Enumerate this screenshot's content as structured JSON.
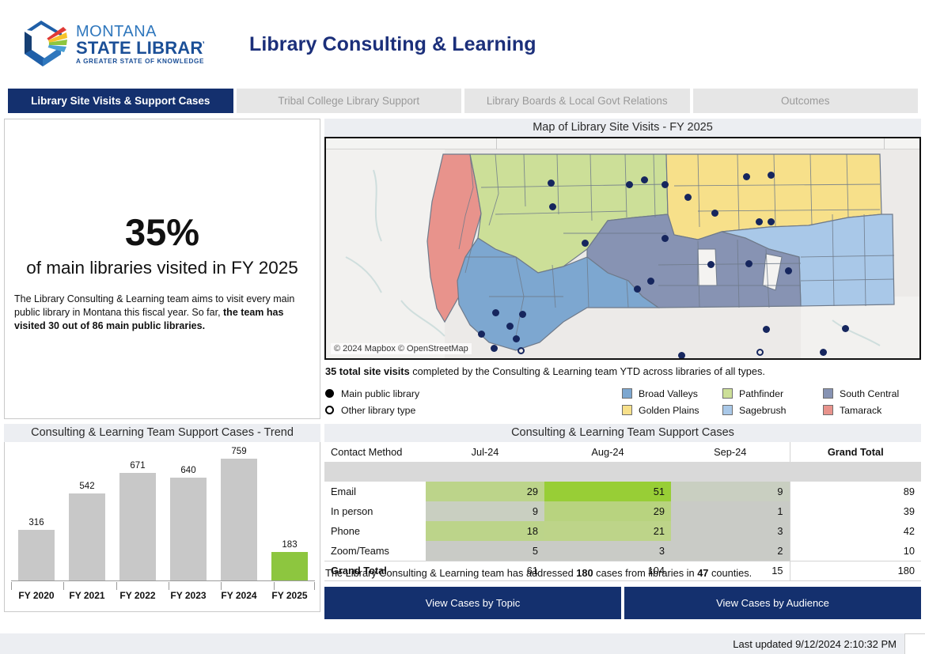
{
  "header": {
    "logo_alt": "Montana State Library",
    "logo_line1": "MONTANA",
    "logo_line2": "STATE LIBRARY",
    "logo_tagline": "A GREATER STATE OF KNOWLEDGE",
    "title": "Library Consulting & Learning"
  },
  "tabs": [
    {
      "label": "Library Site Visits & Support Cases",
      "active": true
    },
    {
      "label": "Tribal College Library Support",
      "active": false
    },
    {
      "label": "Library Boards & Local Govt Relations",
      "active": false
    },
    {
      "label": "Outcomes",
      "active": false
    }
  ],
  "kpi": {
    "value": "35%",
    "subtitle": "of main libraries visited in FY 2025",
    "paragraph_plain_1": "The Library Consulting & Learning team aims to visit every main public library in Montana this fiscal year. So far, ",
    "paragraph_bold": "the team has visited 30 out of 86 main public libraries."
  },
  "map": {
    "title": "Map of Library Site Visits - FY 2025",
    "attribution": "© 2024 Mapbox © OpenStreetMap",
    "caption_bold": "35 total site visits",
    "caption_rest": " completed by the Consulting & Learning team YTD across libraries of all types.",
    "marker_legend": [
      {
        "label": "Main public library",
        "style": "filled"
      },
      {
        "label": "Other library type",
        "style": "hollow"
      }
    ],
    "region_legend": [
      {
        "label": "Broad Valleys",
        "color": "#7da7d0"
      },
      {
        "label": "Golden Plains",
        "color": "#f7e08a"
      },
      {
        "label": "Pathfinder",
        "color": "#ccdf98"
      },
      {
        "label": "Sagebrush",
        "color": "#a9c8e8"
      },
      {
        "label": "South Central",
        "color": "#8793b3"
      },
      {
        "label": "Tamarack",
        "color": "#e8938c"
      }
    ]
  },
  "chart_data": {
    "type": "bar",
    "title": "Consulting & Learning Team Support Cases - Trend",
    "categories": [
      "FY 2020",
      "FY 2021",
      "FY 2022",
      "FY 2023",
      "FY 2024",
      "FY 2025"
    ],
    "values": [
      316,
      542,
      671,
      640,
      759,
      183
    ],
    "bar_colors": [
      "#c8c8c8",
      "#c8c8c8",
      "#c8c8c8",
      "#c8c8c8",
      "#c8c8c8",
      "#8dc63f"
    ],
    "xlabel": "",
    "ylabel": "",
    "ylim": [
      0,
      820
    ],
    "grid": false,
    "legend": "none",
    "data_labels": true
  },
  "cases_table": {
    "title": "Consulting & Learning Team Support Cases",
    "columns": [
      "Contact Method",
      "Jul-24",
      "Aug-24",
      "Sep-24",
      "Grand Total"
    ],
    "rows": [
      {
        "label": "Email",
        "values": [
          "29",
          "51",
          "9"
        ],
        "cell_colors": [
          "#bcd48a",
          "#98ce36",
          "#c9cfc1"
        ],
        "total": "89"
      },
      {
        "label": "In person",
        "values": [
          "9",
          "29",
          "1"
        ],
        "cell_colors": [
          "#c9cfc1",
          "#b8d37f",
          "#c9cbc6"
        ],
        "total": "39"
      },
      {
        "label": "Phone",
        "values": [
          "18",
          "21",
          "3"
        ],
        "cell_colors": [
          "#bcd48a",
          "#bdd489",
          "#c9cbc6"
        ],
        "total": "42"
      },
      {
        "label": "Zoom/Teams",
        "values": [
          "5",
          "3",
          "2"
        ],
        "cell_colors": [
          "#c9cbc6",
          "#c9cbc6",
          "#c9cbc6"
        ],
        "total": "10"
      }
    ],
    "grand_total_label": "Grand Total",
    "grand_total_values": [
      "61",
      "104",
      "15"
    ],
    "grand_total": "180"
  },
  "cases_note": {
    "text_1": "The Library Consulting & Learning team has addressed ",
    "bold_1": "180",
    "text_2": " cases from libraries in ",
    "bold_2": "47",
    "text_3": " counties."
  },
  "buttons": [
    {
      "label": "View Cases by Topic"
    },
    {
      "label": "View Cases by Audience"
    }
  ],
  "footer": {
    "last_updated": "Last updated 9/12/2024 2:10:32 PM"
  },
  "colors": {
    "brand_navy": "#14306e",
    "title_navy": "#1b2f7a",
    "accent_green": "#8dc63f",
    "panel_header": "#eceef2"
  }
}
